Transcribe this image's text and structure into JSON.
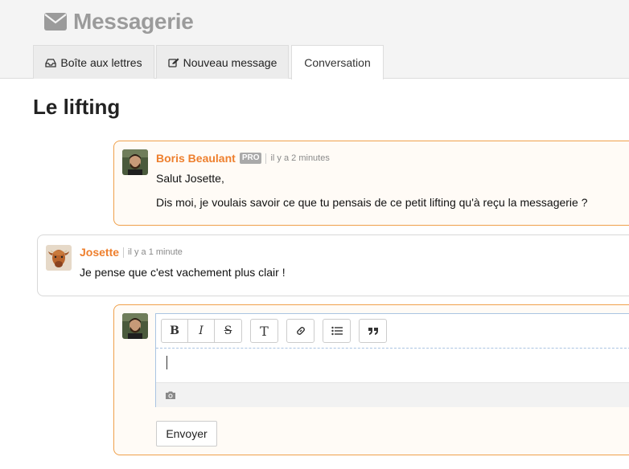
{
  "app": {
    "title": "Messagerie",
    "icon": "envelope-icon"
  },
  "tabs": [
    {
      "label": "Boîte aux lettres",
      "icon": "inbox-icon"
    },
    {
      "label": "Nouveau message",
      "icon": "edit-icon"
    },
    {
      "label": "Conversation",
      "active": true
    }
  ],
  "conversation": {
    "title": "Le lifting",
    "messages": [
      {
        "author": "Boris Beaulant",
        "badge": "PRO",
        "time": "il y a 2 minutes",
        "lines": [
          "Salut Josette,",
          "Dis moi, je voulais savoir ce que tu pensais de ce petit lifting qu'à reçu la messagerie ?"
        ],
        "accent": "#f0a04b"
      },
      {
        "author": "Josette",
        "time": "il y a 1 minute",
        "lines": [
          "Je pense que c'est vachement plus clair !"
        ],
        "accent": "#d8d8d8"
      }
    ]
  },
  "editor": {
    "toolbar": [
      {
        "name": "bold",
        "label": "B"
      },
      {
        "name": "italic",
        "label": "I"
      },
      {
        "name": "strikethrough",
        "label": "S"
      },
      {
        "name": "heading",
        "label": "T"
      },
      {
        "name": "link",
        "icon": "link-icon"
      },
      {
        "name": "list",
        "icon": "list-icon"
      },
      {
        "name": "quote",
        "icon": "quote-icon"
      }
    ],
    "value": "",
    "attach_icon": "camera-icon",
    "send_label": "Envoyer"
  },
  "colors": {
    "accent": "#ee7f2d",
    "border_orange": "#f0a04b",
    "header_bg": "#f4f4f4",
    "title_gray": "#9b9b9b"
  }
}
